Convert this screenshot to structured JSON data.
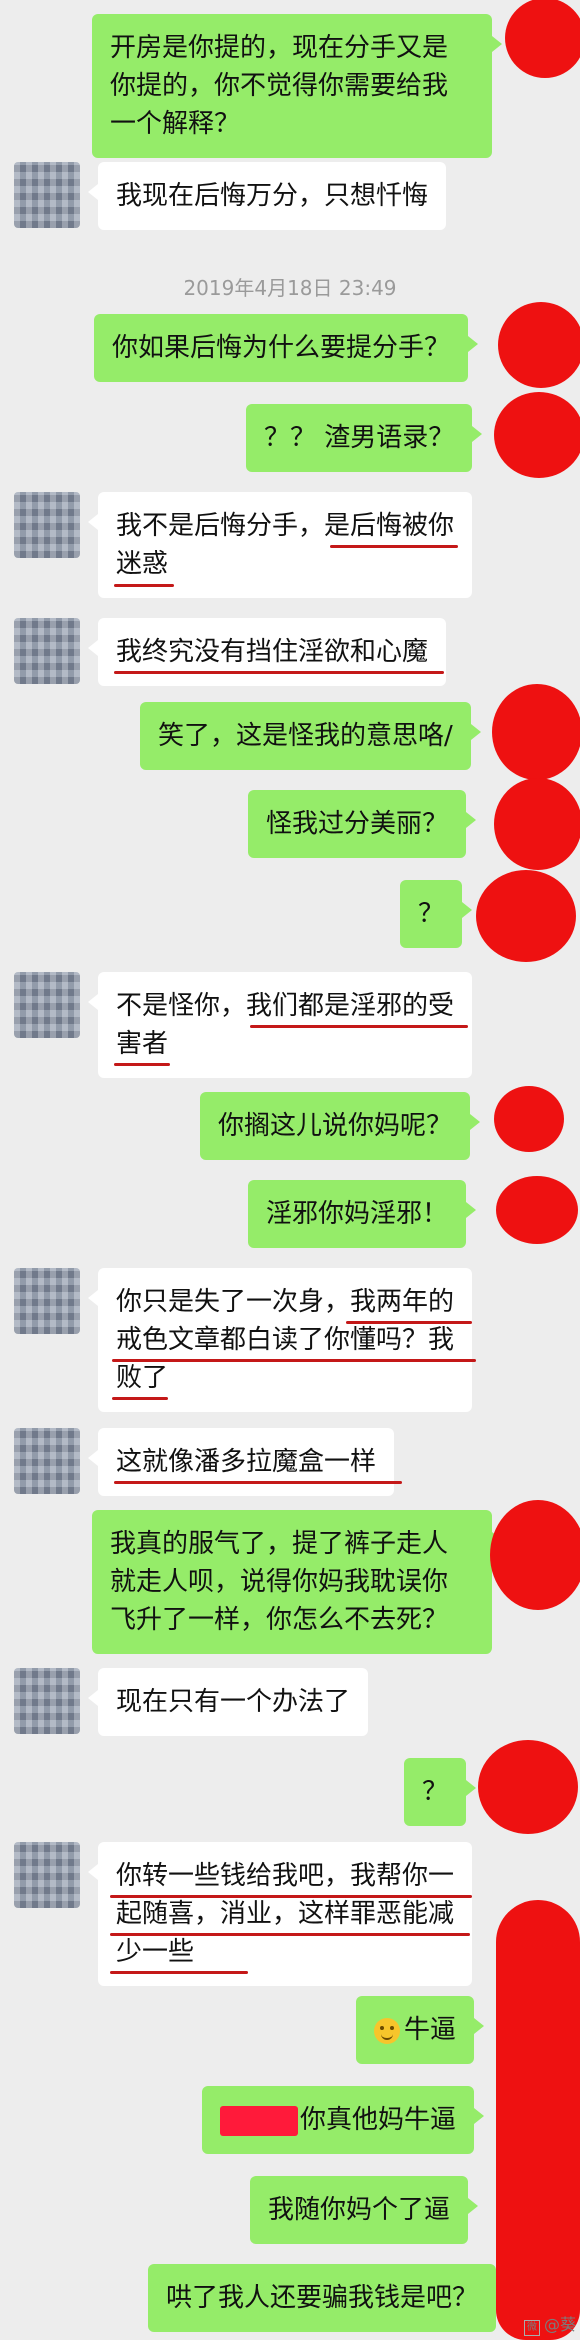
{
  "chat": {
    "timestamp": "2019年4月18日 23:49",
    "messages": [
      {
        "side": "me",
        "lines": [
          "开房是你提的，现在分手又是",
          "你提的，你不觉得你需要给我",
          "一个解释？"
        ]
      },
      {
        "side": "them",
        "lines": [
          "我现在后悔万分，只想忏悔"
        ]
      },
      {
        "side": "me",
        "lines": [
          "你如果后悔为什么要提分手？"
        ]
      },
      {
        "side": "me",
        "lines": [
          "？？ 渣男语录？"
        ]
      },
      {
        "side": "them",
        "lines": [
          "我不是后悔分手，是后悔被你",
          "迷惑"
        ]
      },
      {
        "side": "them",
        "lines": [
          "我终究没有挡住淫欲和心魔"
        ]
      },
      {
        "side": "me",
        "lines": [
          "笑了，这是怪我的意思咯/"
        ]
      },
      {
        "side": "me",
        "lines": [
          "怪我过分美丽？"
        ]
      },
      {
        "side": "me",
        "lines": [
          "？"
        ]
      },
      {
        "side": "them",
        "lines": [
          "不是怪你，我们都是淫邪的受",
          "害者"
        ]
      },
      {
        "side": "me",
        "lines": [
          "你搁这儿说你妈呢？"
        ]
      },
      {
        "side": "me",
        "lines": [
          "淫邪你妈淫邪！"
        ]
      },
      {
        "side": "them",
        "lines": [
          "你只是失了一次身，我两年的",
          "戒色文章都白读了你懂吗？我",
          "败了"
        ]
      },
      {
        "side": "them",
        "lines": [
          "这就像潘多拉魔盒一样"
        ]
      },
      {
        "side": "me",
        "lines": [
          "我真的服气了，提了裤子走人",
          "就走人呗，说得你妈我耽误你",
          "飞升了一样，你怎么不去死？"
        ]
      },
      {
        "side": "them",
        "lines": [
          "现在只有一个办法了"
        ]
      },
      {
        "side": "me",
        "lines": [
          "？"
        ]
      },
      {
        "side": "them",
        "lines": [
          "你转一些钱给我吧，我帮你一",
          "起随喜，消业，这样罪恶能减",
          "少一些"
        ]
      },
      {
        "side": "me",
        "lines": [
          "牛逼"
        ]
      },
      {
        "side": "me",
        "lines": [
          "你真他妈牛逼"
        ]
      },
      {
        "side": "me",
        "lines": [
          "我随你妈个了逼"
        ]
      },
      {
        "side": "me",
        "lines": [
          "哄了我人还要骗我钱是吧？"
        ]
      }
    ]
  },
  "watermark": {
    "label": "@葵"
  },
  "colors": {
    "me_bubble": "#95ec69",
    "them_bubble": "#ffffff",
    "redaction": "#ee1111"
  }
}
